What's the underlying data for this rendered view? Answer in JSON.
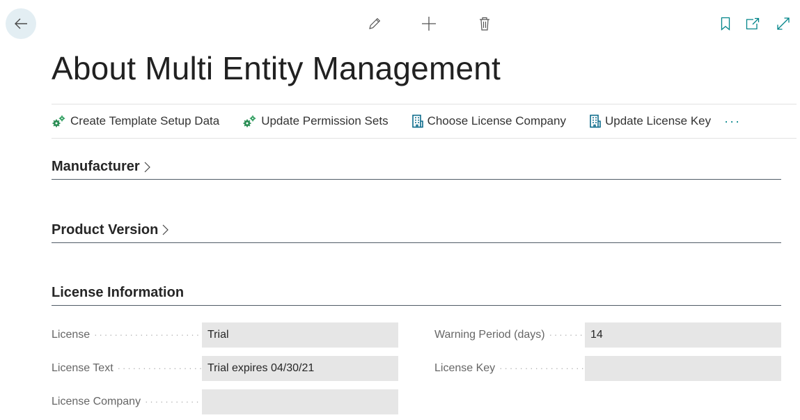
{
  "toolbar": {
    "icons": [
      "back-arrow-icon",
      "pencil-icon",
      "plus-icon",
      "trash-icon",
      "bookmark-icon",
      "open-new-window-icon",
      "expand-icon"
    ]
  },
  "page": {
    "title": "About Multi Entity Management"
  },
  "actions": {
    "items": [
      {
        "label": "Create Template Setup Data",
        "icon": "gears-icon"
      },
      {
        "label": "Update Permission Sets",
        "icon": "gears-icon"
      },
      {
        "label": "Choose License Company",
        "icon": "building-icon"
      },
      {
        "label": "Update License Key",
        "icon": "building-icon"
      }
    ],
    "more_label": "···"
  },
  "sections": {
    "manufacturer": {
      "title": "Manufacturer"
    },
    "product_version": {
      "title": "Product Version"
    },
    "license_information": {
      "title": "License Information"
    }
  },
  "fields": {
    "license": {
      "label": "License",
      "value": "Trial"
    },
    "license_text": {
      "label": "License Text",
      "value": "Trial expires 04/30/21"
    },
    "license_company": {
      "label": "License Company",
      "value": ""
    },
    "warning_period": {
      "label": "Warning Period (days)",
      "value": "14"
    },
    "license_key": {
      "label": "License Key",
      "value": ""
    }
  },
  "colors": {
    "accent": "#008489",
    "field_background": "#e6e6e6",
    "back_button_background": "#e3eef3"
  }
}
